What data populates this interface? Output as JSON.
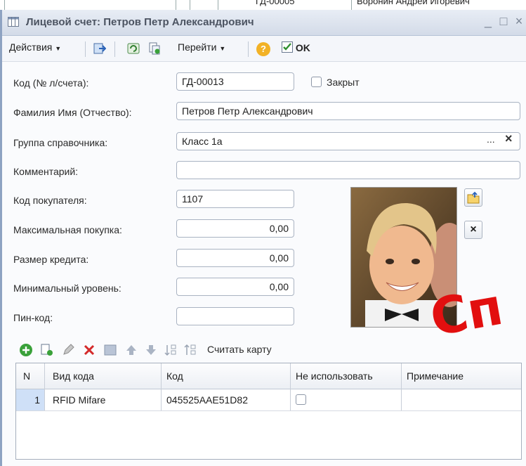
{
  "background_row": {
    "code": "ГД-00005",
    "name": "Воронин Андрей Игоревич"
  },
  "window": {
    "title": "Лицевой счет: Петров Петр Александрович",
    "controls": {
      "minimize": "_",
      "maximize": "□",
      "close": "×"
    }
  },
  "toolbar": {
    "actions_label": "Действия",
    "goto_label": "Перейти",
    "help_symbol": "?",
    "ok_label": "OK"
  },
  "form": {
    "code_label": "Код (№ л/счета):",
    "code_value": "ГД-00013",
    "closed_label": "Закрыт",
    "closed_checked": false,
    "fio_label": "Фамилия Имя (Отчество):",
    "fio_value": "Петров Петр Александрович",
    "group_label": "Группа справочника:",
    "group_value": "Класс 1а",
    "group_select_btn": "...",
    "group_clear_btn": "×",
    "comment_label": "Комментарий:",
    "comment_value": "",
    "buyer_code_label": "Код покупателя:",
    "buyer_code_value": "1107",
    "max_purchase_label": "Максимальная покупка:",
    "max_purchase_value": "0,00",
    "credit_label": "Размер кредита:",
    "credit_value": "0,00",
    "min_level_label": "Минимальный уровень:",
    "min_level_value": "0,00",
    "pin_label": "Пин-код:",
    "pin_value": "",
    "photo_clear_btn": "×"
  },
  "codes_toolbar": {
    "read_card_label": "Считать карту"
  },
  "codes_table": {
    "columns": [
      "N",
      "Вид кода",
      "Код",
      "Не использовать",
      "Примечание"
    ],
    "rows": [
      {
        "n": "1",
        "type": "RFID Mifare",
        "code": "045525AAE51D82",
        "unused": false,
        "note": ""
      }
    ]
  },
  "watermark": "Сп",
  "colors": {
    "accent_red": "#e20f0f",
    "window_border": "#8ea3c2",
    "add_green": "#3aa13a"
  }
}
